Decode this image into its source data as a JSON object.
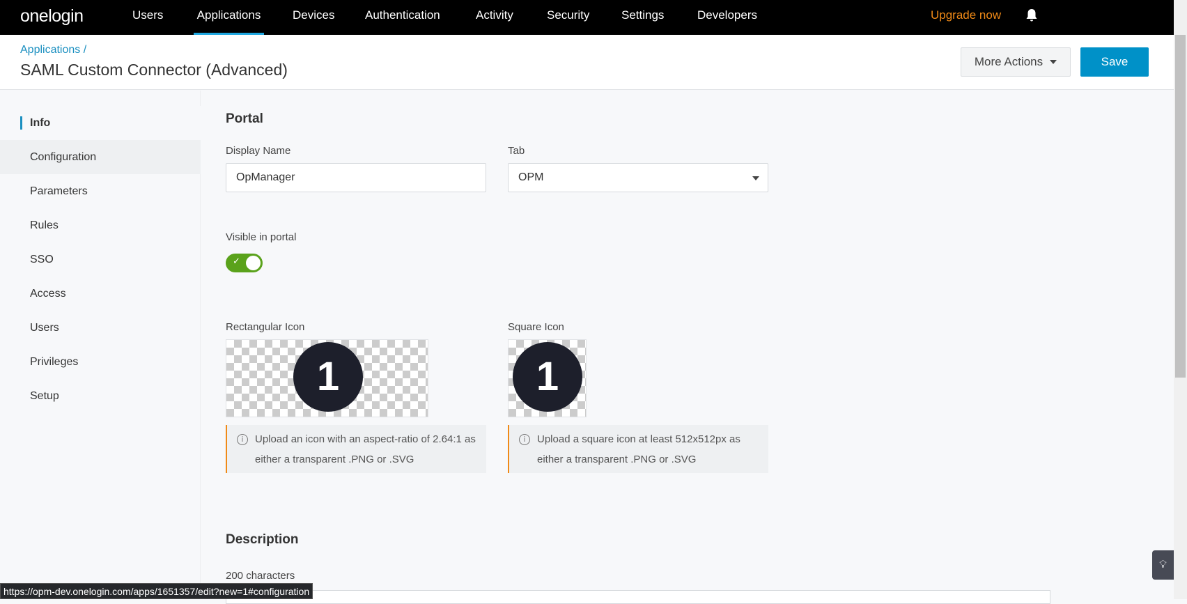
{
  "topbar": {
    "logo": "onelogin",
    "nav": [
      "Users",
      "Applications",
      "Devices",
      "Authentication",
      "Activity",
      "Security",
      "Settings",
      "Developers"
    ],
    "active": "Applications",
    "upgrade": "Upgrade now"
  },
  "header": {
    "breadcrumb": "Applications /",
    "title": "SAML Custom Connector (Advanced)",
    "more_actions": "More Actions",
    "save": "Save"
  },
  "sidebar": {
    "items": [
      "Info",
      "Configuration",
      "Parameters",
      "Rules",
      "SSO",
      "Access",
      "Users",
      "Privileges",
      "Setup"
    ]
  },
  "portal": {
    "heading": "Portal",
    "display_name_label": "Display Name",
    "display_name_value": "OpManager",
    "tab_label": "Tab",
    "tab_value": "OPM",
    "visible_label": "Visible in portal",
    "visible": true,
    "rect_icon_label": "Rectangular Icon",
    "square_icon_label": "Square Icon",
    "icon_glyph": "1",
    "rect_note_1": "Upload an icon with an aspect-ratio of 2.64:1 as",
    "rect_note_2": "either a transparent .PNG or .SVG",
    "square_note_1": "Upload a square icon at least 512x512px as",
    "square_note_2": "either a transparent .PNG or .SVG"
  },
  "description": {
    "heading": "Description",
    "counter": "200 characters"
  },
  "status_url": "https://opm-dev.onelogin.com/apps/1651357/edit?new=1#configuration",
  "colors": {
    "accent": "#0091c8",
    "upgrade": "#f08a17",
    "toggle": "#5aa21b"
  }
}
